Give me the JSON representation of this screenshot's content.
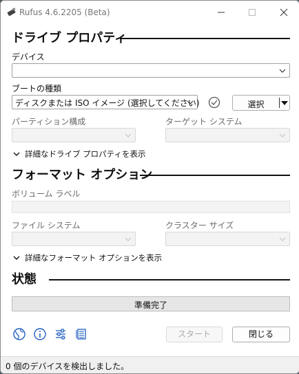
{
  "window": {
    "title": "Rufus 4.6.2205 (Beta)",
    "controls": {
      "minimize": "minimize-icon",
      "maximize": "maximize-icon",
      "close": "close-icon"
    }
  },
  "drive_properties": {
    "header": "ドライブ プロパティ",
    "device_label": "デバイス",
    "device_value": "",
    "boot_label": "ブートの種類",
    "boot_value": "ディスクまたは ISO イメージ (選択してください)",
    "select_button": "選択",
    "partition_label": "パーティション構成",
    "partition_value": "",
    "target_label": "ターゲット システム",
    "target_value": "",
    "advanced_toggle": "詳細なドライブ プロパティを表示"
  },
  "format_options": {
    "header": "フォーマット オプション",
    "volume_label": "ボリューム ラベル",
    "volume_value": "",
    "filesystem_label": "ファイル システム",
    "filesystem_value": "",
    "cluster_label": "クラスター サイズ",
    "cluster_value": "",
    "advanced_toggle": "詳細なフォーマット オプションを表示"
  },
  "status": {
    "header": "状態",
    "progress_text": "準備完了",
    "progress_fraction": 0
  },
  "toolbar": {
    "icons": [
      "globe-icon",
      "info-icon",
      "settings-sliders-icon",
      "log-icon"
    ],
    "start_button": "スタート",
    "close_button": "閉じる"
  },
  "statusbar": {
    "text": "0 個のデバイスを検出しました。"
  },
  "colors": {
    "accent_blue": "#1f5fbf",
    "progress_green": "#06b025",
    "disabled_fill": "#f3f3f3"
  }
}
